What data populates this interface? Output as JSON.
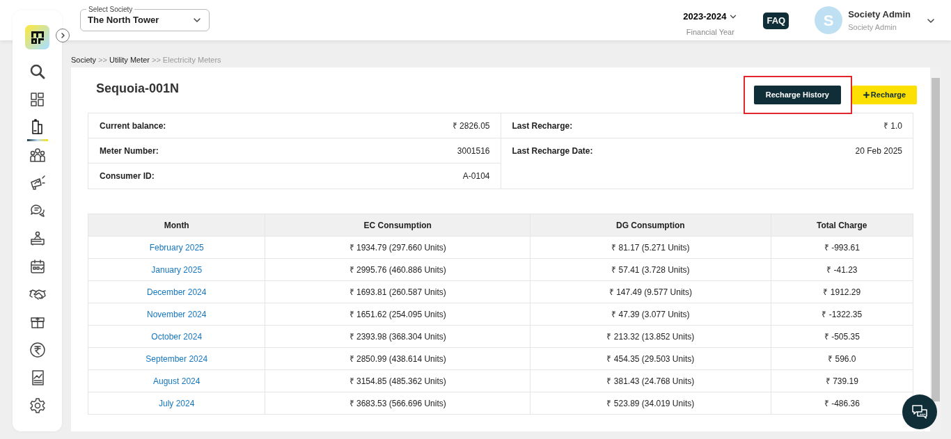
{
  "header": {
    "society_select": {
      "label": "Select Society",
      "value": "The North Tower"
    },
    "financial_year": {
      "value": "2023-2024",
      "label": "Financial Year"
    },
    "faq": "FAQ",
    "user": {
      "initial": "S",
      "name": "Society Admin",
      "role": "Society Admin"
    }
  },
  "sidebar": {
    "items": [
      {
        "kind": "search",
        "selected": false
      },
      {
        "kind": "grid",
        "selected": false
      },
      {
        "kind": "building",
        "selected": true
      },
      {
        "kind": "people",
        "selected": false
      },
      {
        "kind": "megaphone",
        "selected": false
      },
      {
        "kind": "chat",
        "selected": false
      },
      {
        "kind": "desk",
        "selected": false
      },
      {
        "kind": "calendar",
        "selected": false
      },
      {
        "kind": "handshake",
        "selected": false
      },
      {
        "kind": "box",
        "selected": false
      },
      {
        "kind": "rupee",
        "selected": false
      },
      {
        "kind": "report",
        "selected": false
      },
      {
        "kind": "gear",
        "selected": false
      }
    ]
  },
  "breadcrumb": [
    {
      "label": "Society",
      "current": false
    },
    {
      "label": "Utility Meter",
      "current": false
    },
    {
      "label": "Electricity Meters",
      "current": true
    }
  ],
  "breadcrumb_separator": ">>",
  "meter": {
    "title": "Sequoia-001N",
    "buttons": [
      {
        "label": "Recharge History",
        "kind": "dark",
        "highlighted": true
      },
      {
        "label": "Recharge",
        "kind": "add",
        "highlighted": false
      }
    ],
    "details_left": [
      {
        "label": "Current balance:",
        "value": "₹ 2826.05"
      },
      {
        "label": "Meter Number:",
        "value": "3001516"
      },
      {
        "label": "Consumer ID:",
        "value": "A-0104"
      }
    ],
    "details_right": [
      {
        "label": "Last Recharge:",
        "value": "₹ 1.0"
      },
      {
        "label": "Last Recharge Date:",
        "value": "20 Feb 2025"
      }
    ]
  },
  "table": {
    "columns": [
      "Month",
      "EC Consumption",
      "DG Consumption",
      "Total Charge"
    ],
    "rows": [
      [
        "February 2025",
        "₹ 1934.79 (297.660 Units)",
        "₹ 81.17 (5.271 Units)",
        "₹ -993.61"
      ],
      [
        "January 2025",
        "₹ 2995.76 (460.886 Units)",
        "₹ 57.41 (3.728 Units)",
        "₹ -41.23"
      ],
      [
        "December 2024",
        "₹ 1693.81 (260.587 Units)",
        "₹ 147.49 (9.577 Units)",
        "₹ 1912.29"
      ],
      [
        "November 2024",
        "₹ 1651.62 (254.095 Units)",
        "₹ 47.39 (3.077 Units)",
        "₹ -1322.35"
      ],
      [
        "October 2024",
        "₹ 2393.98 (368.304 Units)",
        "₹ 213.32 (13.852 Units)",
        "₹ -505.35"
      ],
      [
        "September 2024",
        "₹ 2850.99 (438.614 Units)",
        "₹ 454.35 (29.503 Units)",
        "₹ 596.0"
      ],
      [
        "August 2024",
        "₹ 3154.85 (485.362 Units)",
        "₹ 381.43 (24.768 Units)",
        "₹ 739.19"
      ],
      [
        "July 2024",
        "₹ 3683.53 (566.696 Units)",
        "₹ 523.89 (34.019 Units)",
        "₹ -486.36"
      ]
    ]
  }
}
